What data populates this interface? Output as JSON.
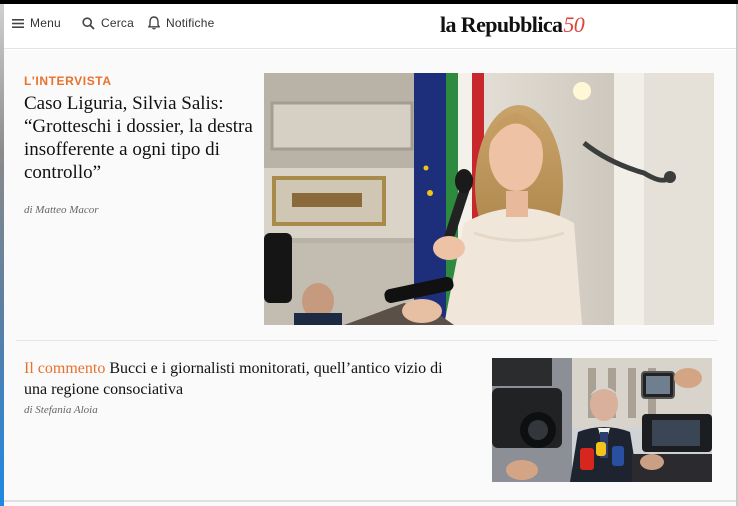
{
  "header": {
    "menu_label": "Menu",
    "search_label": "Cerca",
    "notifications_label": "Notifiche",
    "logo_text": "la Repubblica",
    "logo_anniversary": "50"
  },
  "lead_story": {
    "kicker": "L'INTERVISTA",
    "headline": "Caso Liguria, Silvia Salis: “Grotteschi i dossier, la destra insofferente a ogni tipo di controllo”",
    "byline": "di Matteo Macor"
  },
  "second_story": {
    "label": "Il commento",
    "headline": "Bucci e i giornalisti monitorati, quell’antico vizio di una regione consociativa",
    "byline": "di Stefania Aloia"
  },
  "icons": [
    "menu-icon",
    "search-icon",
    "bell-icon"
  ],
  "colors": {
    "accent": "#e8712c",
    "logo_fifty": "#e0433a"
  }
}
